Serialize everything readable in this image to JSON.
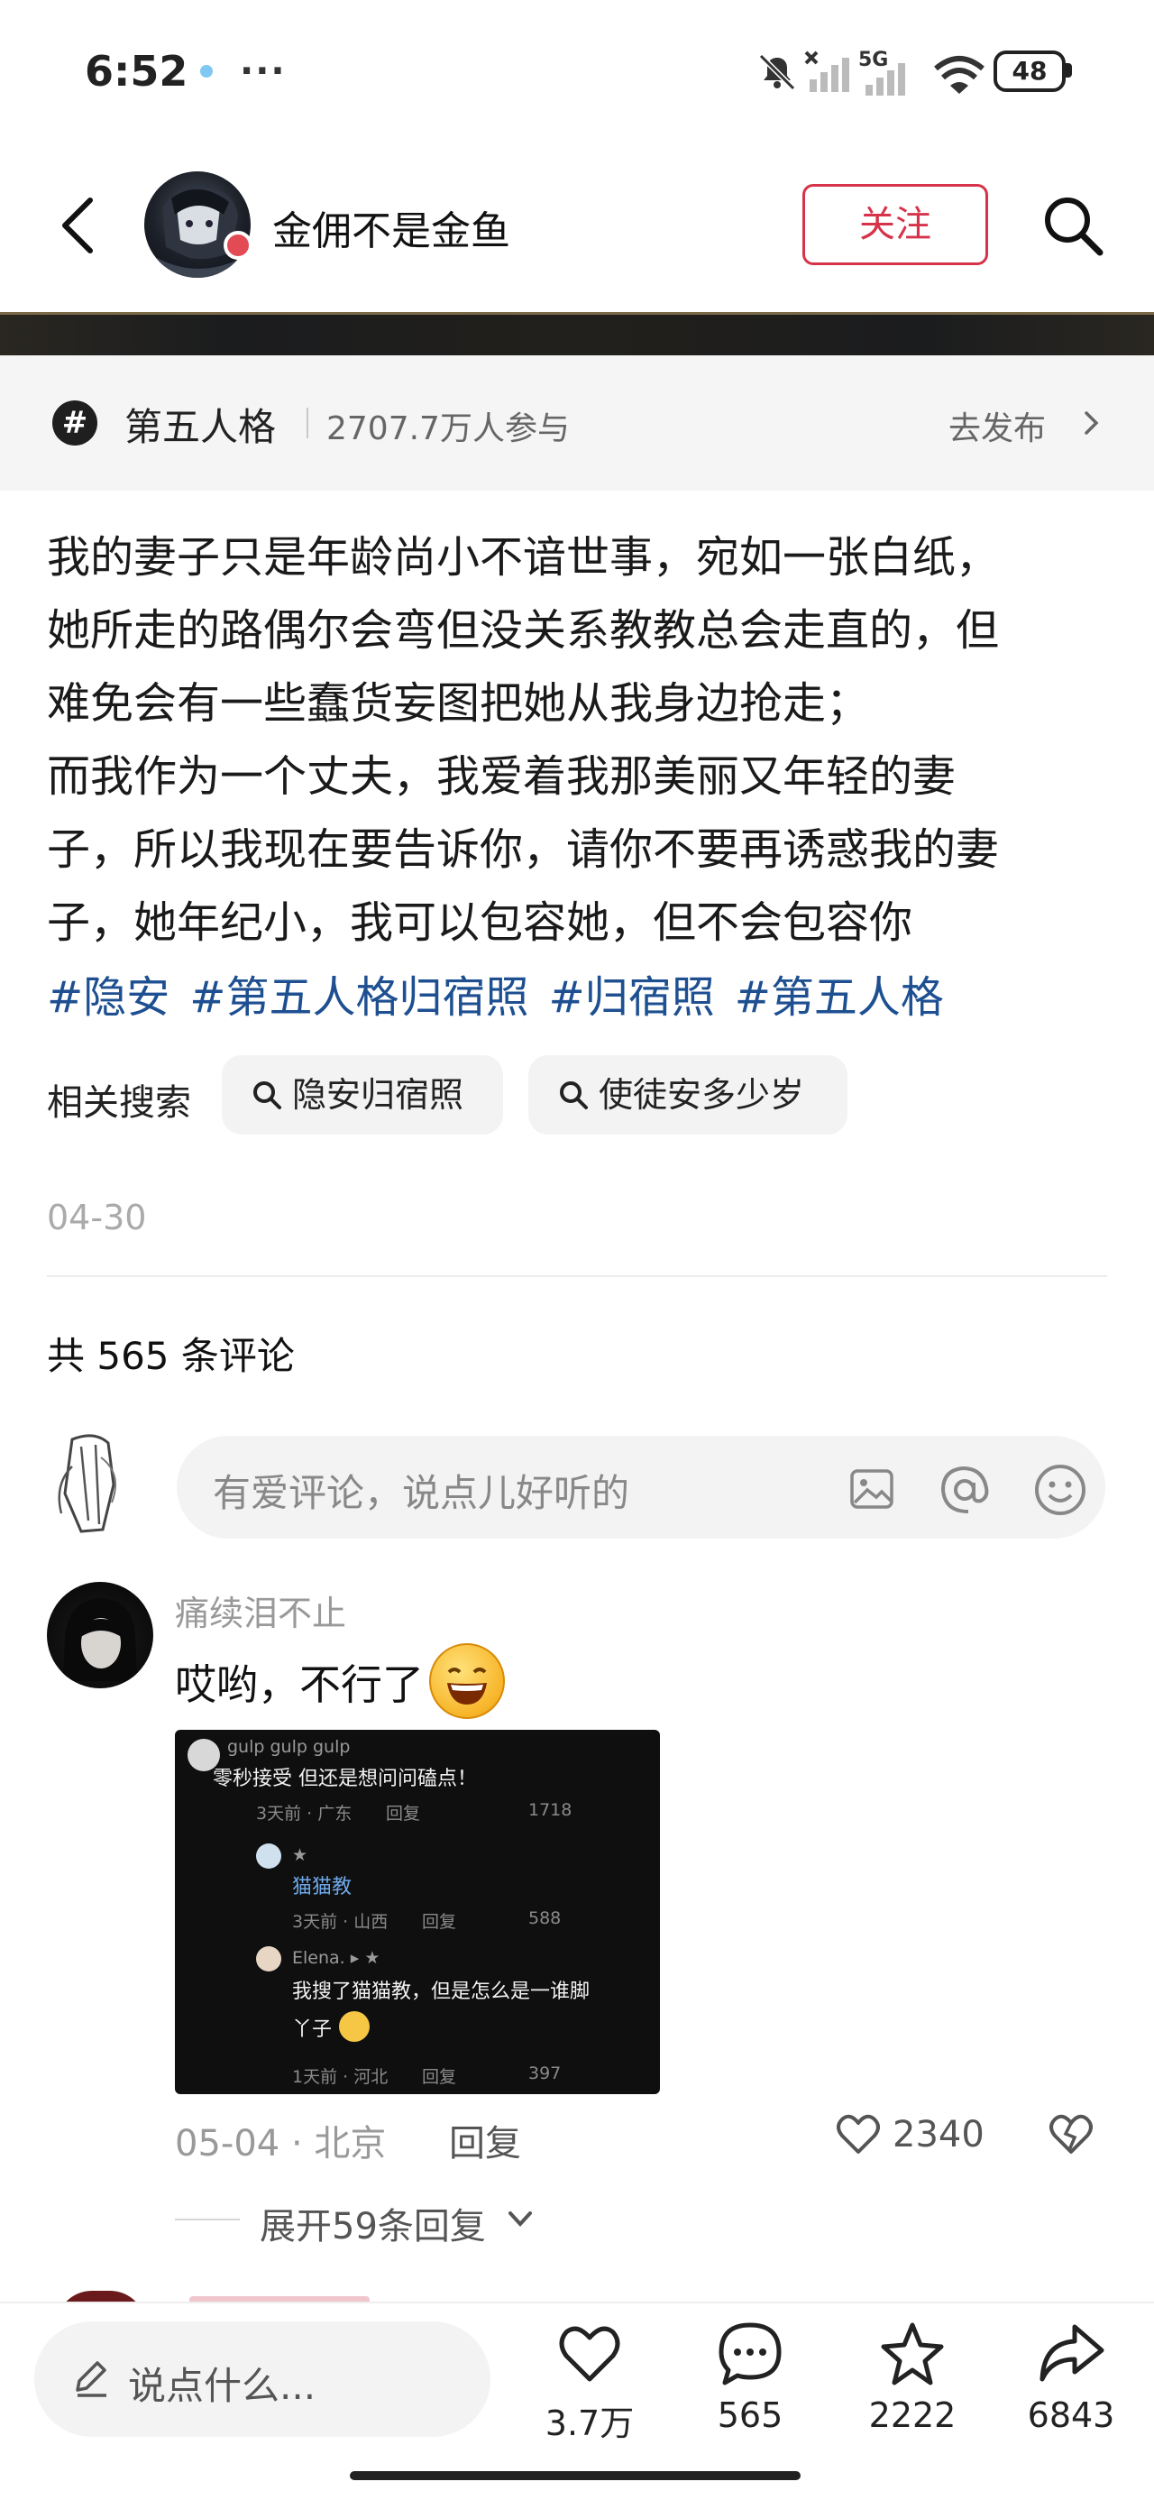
{
  "status_bar": {
    "time": "6:52",
    "more": "···",
    "network": "5G",
    "battery": "48"
  },
  "header": {
    "author": "金佣不是金鱼",
    "follow_label": "关注"
  },
  "topic": {
    "name": "第五人格",
    "participants": "2707.7万人参与",
    "go_label": "去发布"
  },
  "post": {
    "text": "我的妻子只是年龄尚小不谙世事，宛如一张白纸，\n她所走的路偶尔会弯但没关系教教总会走直的，但\n难免会有一些蠢货妄图把她从我身边抢走；\n而我作为一个丈夫，我爱着我那美丽又年轻的妻\n子，所以我现在要告诉你，请你不要再诱惑我的妻\n子，她年纪小，我可以包容她，但不会包容你",
    "tags": [
      "#隐安",
      "#第五人格归宿照",
      "#归宿照",
      "#第五人格"
    ],
    "related_label": "相关搜索",
    "related": [
      "隐安归宿照",
      "使徒安多少岁"
    ],
    "date": "04-30"
  },
  "comments_header": {
    "count_text": "共 565 条评论",
    "input_placeholder": "有爱评论，说点儿好听的"
  },
  "comment": {
    "user": "痛续泪不止",
    "text": "哎哟，不行了",
    "date_loc": "05-04 · 北京",
    "reply_label": "回复",
    "likes": "2340",
    "expand_label": "展开59条回复",
    "image": {
      "r1_name": "gulp gulp gulp",
      "r1_text": "零秒接受 但还是想问问磕点！",
      "r1_meta": "3天前 · 广东",
      "r1_reply": "回复",
      "r1_likes": "1718",
      "r2_name": "★",
      "r2_text": "猫猫教",
      "r2_meta": "3天前 · 山西",
      "r2_reply": "回复",
      "r2_likes": "588",
      "r3_name": "Elena. ▸ ★",
      "r3_text1": "我搜了猫猫教，但是怎么是一谁脚",
      "r3_text2": "丫子",
      "r3_meta": "1天前 · 河北",
      "r3_reply": "回复",
      "r3_likes": "397"
    }
  },
  "bottom_bar": {
    "say_placeholder": "说点什么...",
    "likes": "3.7万",
    "comments": "565",
    "favorites": "2222",
    "shares": "6843"
  }
}
